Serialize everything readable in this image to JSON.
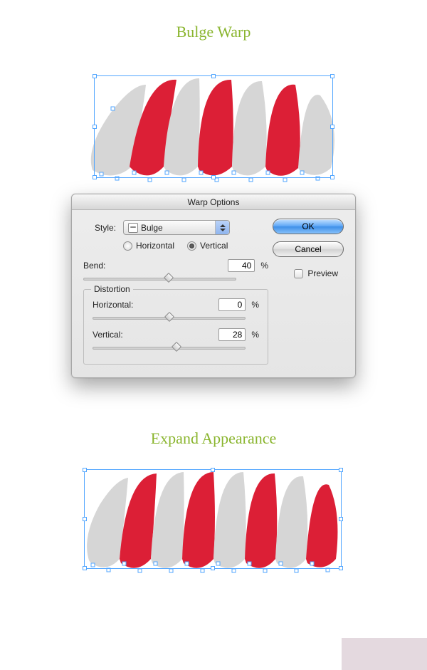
{
  "titles": {
    "bulge": "Bulge Warp",
    "expand": "Expand Appearance"
  },
  "dialog": {
    "title": "Warp Options",
    "style_label": "Style:",
    "style_value": "Bulge",
    "orientation": {
      "horizontal": "Horizontal",
      "vertical": "Vertical",
      "selected": "vertical"
    },
    "bend_label": "Bend:",
    "bend_value": "40",
    "percent": "%",
    "distortion": {
      "legend": "Distortion",
      "horizontal_label": "Horizontal:",
      "horizontal_value": "0",
      "vertical_label": "Vertical:",
      "vertical_value": "28"
    },
    "ok": "OK",
    "cancel": "Cancel",
    "preview_label": "Preview"
  },
  "colors": {
    "red": "#dc1f36",
    "gray": "#d6d6d6",
    "selection": "#52a6ff"
  }
}
